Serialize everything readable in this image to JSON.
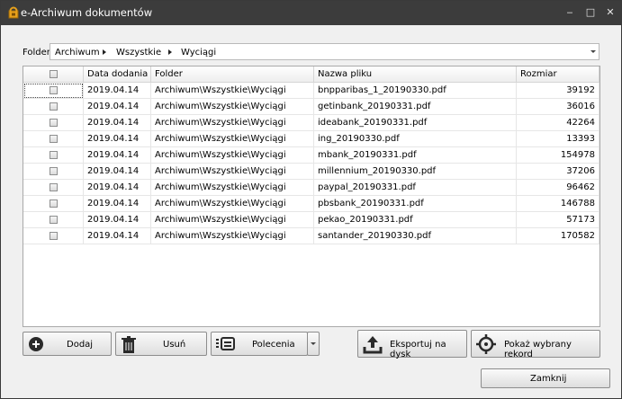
{
  "window": {
    "title": "e-Archiwum dokumentów",
    "controls": {
      "minimize": "‒",
      "maximize": "□",
      "close": "✕"
    }
  },
  "folder": {
    "label": "Folder",
    "path": [
      "Archiwum",
      "Wszystkie",
      "Wyciągi"
    ]
  },
  "table": {
    "columns": [
      "",
      "Data dodania",
      "Folder",
      "Nazwa pliku",
      "Rozmiar"
    ],
    "rows": [
      {
        "date": "2019.04.14",
        "folder": "Archiwum\\Wszystkie\\Wyciągi",
        "file": "bnpparibas_1_20190330.pdf",
        "size": "39192"
      },
      {
        "date": "2019.04.14",
        "folder": "Archiwum\\Wszystkie\\Wyciągi",
        "file": "getinbank_20190331.pdf",
        "size": "36016"
      },
      {
        "date": "2019.04.14",
        "folder": "Archiwum\\Wszystkie\\Wyciągi",
        "file": "ideabank_20190331.pdf",
        "size": "42264"
      },
      {
        "date": "2019.04.14",
        "folder": "Archiwum\\Wszystkie\\Wyciągi",
        "file": "ing_20190330.pdf",
        "size": "13393"
      },
      {
        "date": "2019.04.14",
        "folder": "Archiwum\\Wszystkie\\Wyciągi",
        "file": "mbank_20190331.pdf",
        "size": "154978"
      },
      {
        "date": "2019.04.14",
        "folder": "Archiwum\\Wszystkie\\Wyciągi",
        "file": "millennium_20190330.pdf",
        "size": "37206"
      },
      {
        "date": "2019.04.14",
        "folder": "Archiwum\\Wszystkie\\Wyciągi",
        "file": "paypal_20190331.pdf",
        "size": "96462"
      },
      {
        "date": "2019.04.14",
        "folder": "Archiwum\\Wszystkie\\Wyciągi",
        "file": "pbsbank_20190331.pdf",
        "size": "146788"
      },
      {
        "date": "2019.04.14",
        "folder": "Archiwum\\Wszystkie\\Wyciągi",
        "file": "pekao_20190331.pdf",
        "size": "57173"
      },
      {
        "date": "2019.04.14",
        "folder": "Archiwum\\Wszystkie\\Wyciągi",
        "file": "santander_20190330.pdf",
        "size": "170582"
      }
    ]
  },
  "buttons": {
    "add": "Dodaj",
    "delete": "Usuń",
    "commands": "Polecenia",
    "export": "Eksportuj na dysk",
    "show": "Pokaż wybrany rekord",
    "close": "Zamknij"
  }
}
